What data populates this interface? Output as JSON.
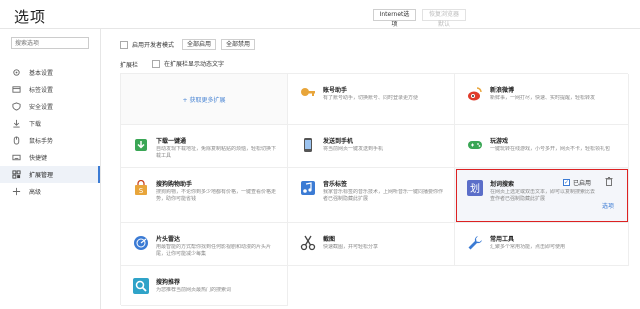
{
  "header": {
    "title": "选项",
    "internet_btn": "Internet选项",
    "reset_btn": "恢复浏览器默认"
  },
  "sidebar": {
    "search_placeholder": "搜索选项",
    "items": [
      {
        "label": "基本设置",
        "icon": "gear-icon"
      },
      {
        "label": "标签设置",
        "icon": "tab-icon"
      },
      {
        "label": "安全设置",
        "icon": "shield-icon"
      },
      {
        "label": "下载",
        "icon": "download-icon"
      },
      {
        "label": "鼠标手势",
        "icon": "mouse-icon"
      },
      {
        "label": "快捷键",
        "icon": "keyboard-icon"
      },
      {
        "label": "扩展管理",
        "icon": "extensions-icon",
        "active": true
      },
      {
        "label": "高级",
        "icon": "advanced-icon"
      }
    ]
  },
  "main": {
    "dev_mode_label": "启用开发者模式",
    "enable_all": "全部启用",
    "disable_all": "全部禁用",
    "bar_title": "扩展栏",
    "bar_option": "在扩展栏显示动态文字"
  },
  "extensions": [
    {
      "kind": "add",
      "label": "+ 获取更多扩展"
    },
    {
      "name": "账号助手",
      "desc": "有了账号助手，切换账号、同时登录更方便",
      "icon": "key-icon",
      "color": "#e8a53a"
    },
    {
      "name": "新浪微博",
      "desc": "新鲜事，一网打尽，快速、实时提醒，轻松转发",
      "icon": "weibo-icon",
      "color": "#e03b2b"
    },
    {
      "name": "下载一键通",
      "desc": "自动发现下载地址，免除复制粘贴的烦恼，轻松切换下载工具",
      "icon": "download-link-icon",
      "color": "#3b7bd4"
    },
    {
      "name": "发送到手机",
      "desc": "将当前网页一键发送到手机",
      "icon": "phone-icon",
      "color": "#555"
    },
    {
      "name": "玩游戏",
      "desc": "一键玩转在线游戏，小号多开，网页不卡，轻松领礼包",
      "icon": "gamepad-icon",
      "color": "#3aa655"
    },
    {
      "name": "搜狗购物助手",
      "desc": "搜狗购物，不论你到多少地都有价格，一键查看价格走势，助你可能省钱",
      "icon": "shopping-icon",
      "color": "#e8a53a"
    },
    {
      "name": "音乐标签",
      "desc": "我家音乐标签的音乐技术，上网听音乐一键同播要你作者已强制隐藏此扩展",
      "icon": "music-icon",
      "color": "#3b7bd4"
    },
    {
      "name": "划词搜索",
      "desc": "在网页上选定或双击文本，即可以复制搜索比去查作者已强制隐藏此扩展",
      "icon": "word-search-icon",
      "color": "#5b6ec9",
      "highlight": true,
      "enabled_label": "已启用",
      "options_label": "选项"
    },
    {
      "name": "片头雷达",
      "desc": "用最智能的方式帮你找到任何影视剧和动漫的片头片尾，让你可能减少每集",
      "icon": "radar-icon",
      "color": "#3b7bd4"
    },
    {
      "name": "截图",
      "desc": "快速截图，并可轻松分享",
      "icon": "scissors-icon",
      "color": "#555"
    },
    {
      "name": "常用工具",
      "desc": "汇聚多个常用功能，点击即可使用",
      "icon": "wrench-icon",
      "color": "#3b7bd4"
    },
    {
      "name": "搜狗推荐",
      "desc": "为您推荐当前网页最热门的搜索词",
      "icon": "magnifier-icon",
      "color": "#2fa3c8"
    }
  ]
}
